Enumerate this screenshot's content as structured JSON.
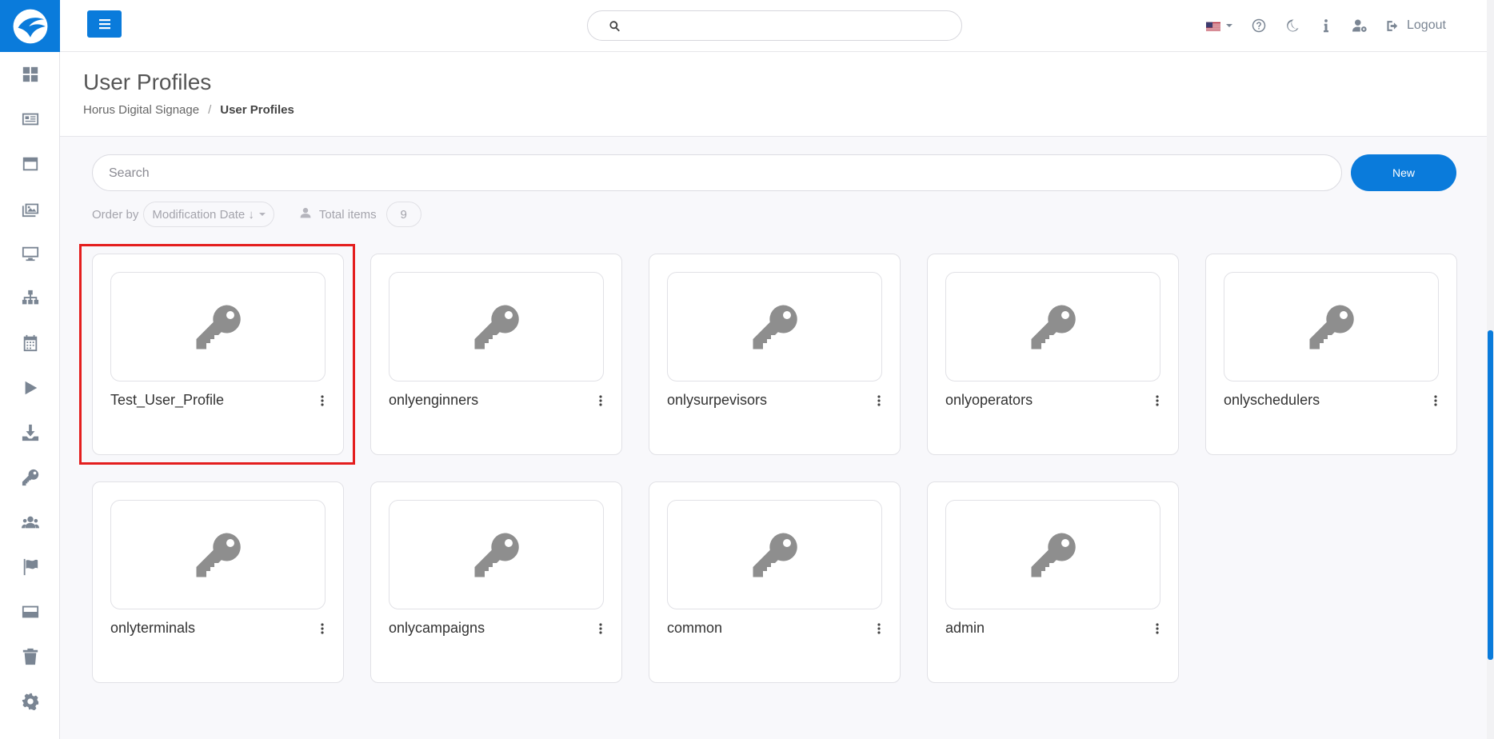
{
  "app": {
    "accent_color": "#0a7bdb",
    "selection_color": "#e41e1e"
  },
  "sidebar": {
    "items": [
      {
        "icon": "dashboard-icon"
      },
      {
        "icon": "contents-icon"
      },
      {
        "icon": "templates-icon"
      },
      {
        "icon": "media-icon"
      },
      {
        "icon": "monitor-icon"
      },
      {
        "icon": "hierarchy-icon"
      },
      {
        "icon": "calendar-icon"
      },
      {
        "icon": "play-icon"
      },
      {
        "icon": "download-icon"
      },
      {
        "icon": "key-icon"
      },
      {
        "icon": "users-icon"
      },
      {
        "icon": "flag-icon"
      },
      {
        "icon": "terminal-icon"
      },
      {
        "icon": "trash-icon"
      },
      {
        "icon": "gear-icon"
      }
    ]
  },
  "topbar": {
    "search_value": "",
    "language": "us-flag-icon",
    "logout_label": "Logout"
  },
  "page": {
    "title": "User Profiles",
    "breadcrumb": {
      "root": "Horus Digital Signage",
      "separator": "/",
      "current": "User Profiles"
    }
  },
  "toolbar": {
    "search_placeholder": "Search",
    "new_label": "New",
    "order_by_label": "Order by",
    "order_by_value": "Modification Date ↓",
    "total_items_label": "Total items",
    "total_items_value": "9"
  },
  "profiles": [
    {
      "name": "Test_User_Profile",
      "selected": true
    },
    {
      "name": "onlyenginners",
      "selected": false
    },
    {
      "name": "onlysurpevisors",
      "selected": false
    },
    {
      "name": "onlyoperators",
      "selected": false
    },
    {
      "name": "onlyschedulers",
      "selected": false
    },
    {
      "name": "onlyterminals",
      "selected": false
    },
    {
      "name": "onlycampaigns",
      "selected": false
    },
    {
      "name": "common",
      "selected": false
    },
    {
      "name": "admin",
      "selected": false
    }
  ]
}
